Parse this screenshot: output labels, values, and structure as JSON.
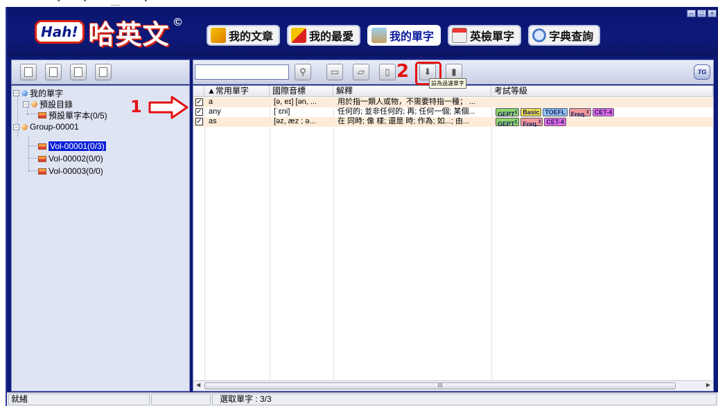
{
  "app": {
    "logo_badge": "Hah!",
    "logo_text": "哈英文",
    "logo_mark": "©",
    "window_controls": [
      "–",
      "□",
      "×"
    ]
  },
  "nav": {
    "tabs": [
      {
        "label": "我的文章",
        "icon": "abc-notebook-icon",
        "active": false
      },
      {
        "label": "我的最愛",
        "icon": "favorite-flag-icon",
        "active": false
      },
      {
        "label": "我的單字",
        "icon": "word-box-icon",
        "active": true
      },
      {
        "label": "英檢單字",
        "icon": "calendar-icon",
        "active": false
      },
      {
        "label": "字典查詢",
        "icon": "magnifier-icon",
        "active": false
      }
    ]
  },
  "toolbar": {
    "search_value": "",
    "tooltip": "設為過濾單字",
    "tg_label": "TG"
  },
  "tree": {
    "root": "我的單字",
    "default_dir": "預設目錄",
    "default_book": "預設單字本(0/5)",
    "group": "Group-00001",
    "volumes": [
      "Vol-00001(0/3)",
      "Vol-00002(0/0)",
      "Vol-00003(0/0)"
    ],
    "selected_volume_index": 0
  },
  "grid": {
    "columns": [
      "▲常用單字",
      "國際音標",
      "解釋",
      "考試等級"
    ],
    "rows": [
      {
        "checked": true,
        "word": "a",
        "ipa": "[ə, eɪ] [ən, ...",
        "definition": "用於指一類人或物，不需要特指一種； ...",
        "levels": []
      },
      {
        "checked": true,
        "word": "any",
        "ipa": "[ˈɛni]",
        "definition": "任何的; 並非任何的; 再; 任何一個; 某個...",
        "levels": [
          {
            "label": "GEPT",
            "sup": "1",
            "color": "#8fd66a"
          },
          {
            "label": "Basic",
            "sup": "",
            "color": "#f2e04a"
          },
          {
            "label": "TOEFL",
            "sup": "",
            "color": "#8fc4f0"
          },
          {
            "label": "Freq.",
            "sup": "3",
            "color": "#f29a9a"
          },
          {
            "label": "CET-4",
            "sup": "",
            "color": "#e86ae8"
          }
        ]
      },
      {
        "checked": true,
        "word": "as",
        "ipa": "[əz, æz ; ə...",
        "definition": "在 同時; 像 樣; 還是 時; 作為; 如...; 由...",
        "levels": [
          {
            "label": "GEPT",
            "sup": "1",
            "color": "#8fd66a"
          },
          {
            "label": "Freq.",
            "sup": "3",
            "color": "#f29a9a"
          },
          {
            "label": "CET-4",
            "sup": "",
            "color": "#e86ae8"
          }
        ]
      }
    ],
    "scroll_grip": "III"
  },
  "annotations": {
    "marker1": "1",
    "marker2": "2"
  },
  "status": {
    "ready": "就緒",
    "selected": "選取單字 : 3/3"
  },
  "colors": {
    "frame": "#0d1a7a",
    "callout": "#e31010",
    "selection": "#0a1fd6",
    "row_shade": "#fdecd9"
  }
}
